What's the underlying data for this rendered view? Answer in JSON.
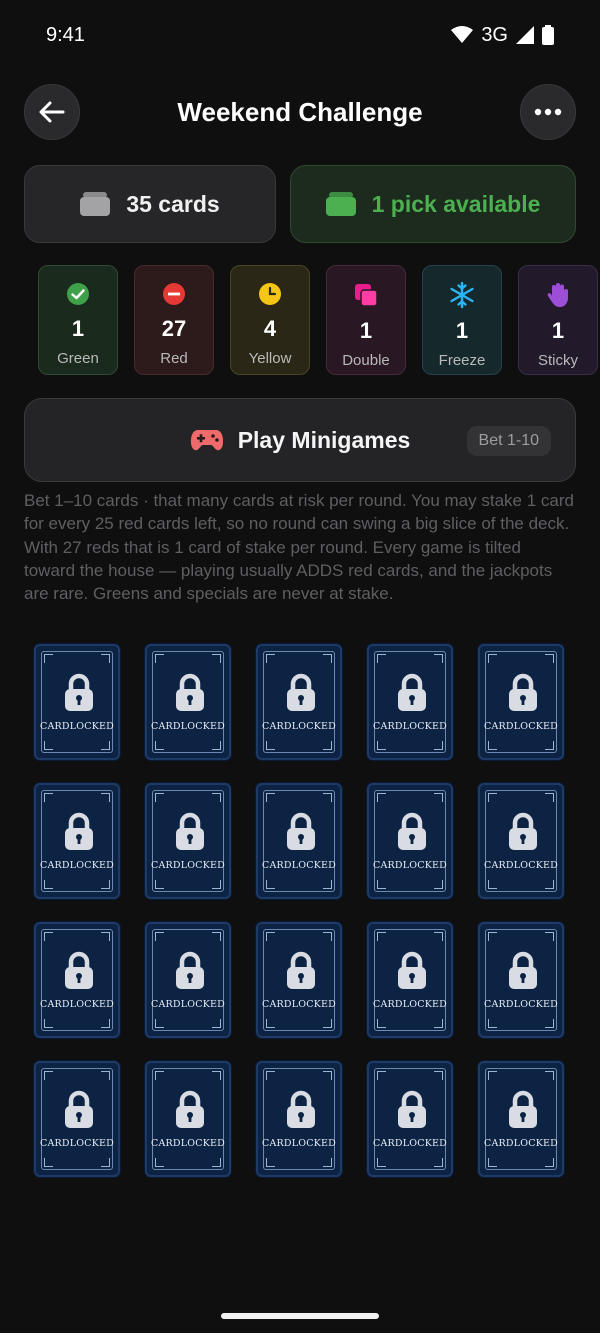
{
  "status_bar": {
    "time": "9:41",
    "network": "3G"
  },
  "header": {
    "title": "Weekend Challenge",
    "back_icon": "arrow-left-icon",
    "menu_icon": "more-horizontal-icon"
  },
  "summary": {
    "deck_label": "35 cards",
    "pick_label": "1 pick available",
    "pick_color": "#4caf50"
  },
  "counts": [
    {
      "id": "green",
      "value": "1",
      "label": "Green",
      "icon": "check-circle-icon",
      "color": "#3fa24a"
    },
    {
      "id": "red",
      "value": "27",
      "label": "Red",
      "icon": "minus-circle-icon",
      "color": "#e53935"
    },
    {
      "id": "yellow",
      "value": "4",
      "label": "Yellow",
      "icon": "clock-icon",
      "color": "#f5c518"
    },
    {
      "id": "double",
      "value": "1",
      "label": "Double",
      "icon": "double-square-icon",
      "color": "#e91e8c"
    },
    {
      "id": "freeze",
      "value": "1",
      "label": "Freeze",
      "icon": "snowflake-icon",
      "color": "#29b6f6"
    },
    {
      "id": "sticky",
      "value": "1",
      "label": "Sticky",
      "icon": "hand-icon",
      "color": "#9c4fd6"
    }
  ],
  "minigames": {
    "label": "Play Minigames",
    "bet_badge": "Bet 1-10",
    "icon": "gamepad-icon"
  },
  "description": "Bet 1–10 cards · that many cards at risk per round. You may stake 1 card for every 25 red cards left, so no round can swing a big slice of the deck. With 27 reds that is 1 card of stake per round. Every game is tilted toward the house — playing usually ADDS red cards, and the jackpots are rare. Greens and specials are never at stake.",
  "cards": {
    "label": "CARDLOCKED",
    "count": 20,
    "icon": "lock-icon"
  }
}
